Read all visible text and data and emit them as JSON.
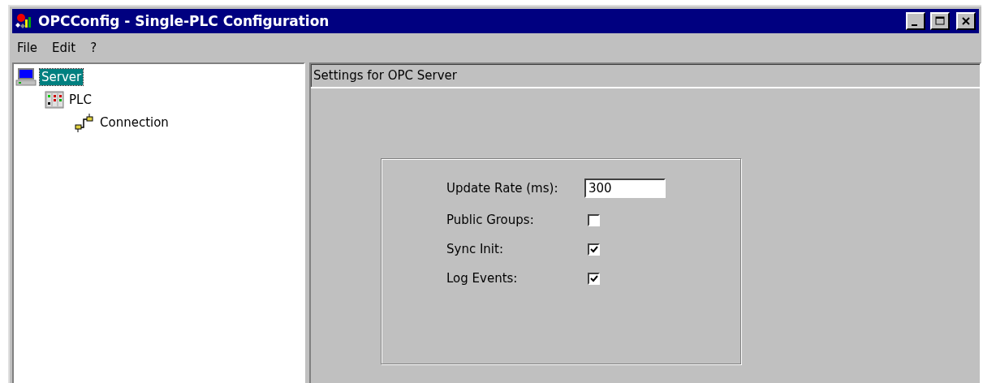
{
  "window": {
    "title": "OPCConfig - Single-PLC Configuration"
  },
  "menu": [
    "File",
    "Edit",
    "?"
  ],
  "tree": [
    {
      "label": "Server",
      "kind": "server",
      "selected": true,
      "children": [
        {
          "label": "PLC",
          "kind": "plc",
          "selected": false,
          "children": [
            {
              "label": "Connection",
              "kind": "connection",
              "selected": false
            }
          ]
        }
      ]
    }
  ],
  "panel": {
    "header": "Settings for OPC Server",
    "fields": [
      {
        "kind": "text",
        "label": "Update Rate (ms):",
        "value": "300"
      },
      {
        "kind": "checkbox",
        "label": "Public Groups:",
        "checked": false
      },
      {
        "kind": "checkbox",
        "label": "Sync Init:",
        "checked": true
      },
      {
        "kind": "checkbox",
        "label": "Log Events:",
        "checked": true
      }
    ]
  }
}
